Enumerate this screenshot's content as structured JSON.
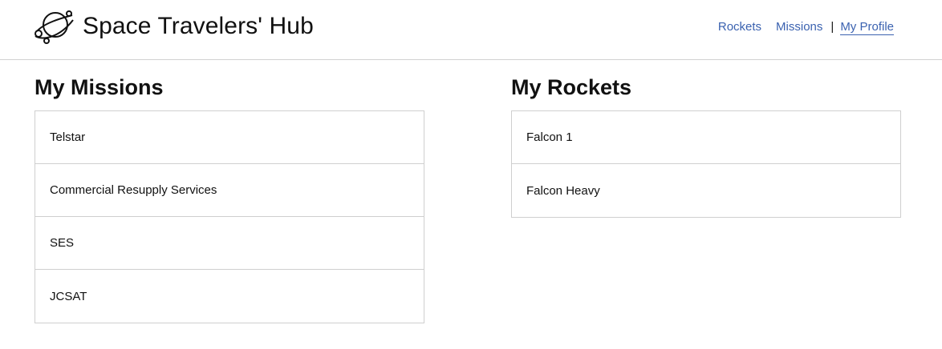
{
  "header": {
    "title": "Space Travelers' Hub",
    "logo_icon": "planet-logo-icon"
  },
  "nav": {
    "rockets": "Rockets",
    "missions": "Missions",
    "separator": "|",
    "my_profile": "My Profile"
  },
  "my_missions": {
    "title": "My Missions",
    "items": [
      "Telstar",
      "Commercial Resupply Services",
      "SES",
      "JCSAT"
    ]
  },
  "my_rockets": {
    "title": "My Rockets",
    "items": [
      "Falcon 1",
      "Falcon Heavy"
    ]
  },
  "colors": {
    "link": "#3b62b0",
    "border": "#cfcfcf",
    "text": "#111111"
  }
}
